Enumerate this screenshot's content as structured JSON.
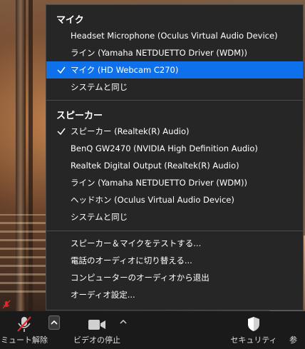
{
  "menu": {
    "mic_header": "マイク",
    "mic_items": [
      {
        "label": "Headset Microphone (Oculus Virtual Audio Device)",
        "checked": false
      },
      {
        "label": "ライン (Yamaha NETDUETTO Driver (WDM))",
        "checked": false
      },
      {
        "label": "マイク (HD Webcam C270)",
        "checked": true
      },
      {
        "label": "システムと同じ",
        "checked": false
      }
    ],
    "speaker_header": "スピーカー",
    "speaker_items": [
      {
        "label": "スピーカー (Realtek(R) Audio)",
        "checked": true
      },
      {
        "label": "BenQ GW2470 (NVIDIA High Definition Audio)",
        "checked": false
      },
      {
        "label": "Realtek Digital Output (Realtek(R) Audio)",
        "checked": false
      },
      {
        "label": "ライン (Yamaha NETDUETTO Driver (WDM))",
        "checked": false
      },
      {
        "label": "ヘッドホン (Oculus Virtual Audio Device)",
        "checked": false
      },
      {
        "label": "システムと同じ",
        "checked": false
      }
    ],
    "action_items": [
      {
        "label": "スピーカー＆マイクをテストする..."
      },
      {
        "label": "電話のオーディオに切り替える..."
      },
      {
        "label": "コンピューターのオーディオから退出"
      },
      {
        "label": "オーディオ設定..."
      }
    ]
  },
  "toolbar": {
    "mute_label": "ミュート解除",
    "video_label": "ビデオの停止",
    "security_label": "セキュリティ",
    "more_label": "参"
  },
  "colors": {
    "menu_bg": "#262626",
    "selected_bg": "#0e71eb",
    "toolbar_bg": "#1a1a1a",
    "mute_red": "#e02828"
  },
  "icons": {
    "check": "check-icon",
    "mic_muted": "microphone-muted-icon",
    "video": "video-camera-icon",
    "security": "shield-icon",
    "caret": "chevron-up-icon"
  }
}
